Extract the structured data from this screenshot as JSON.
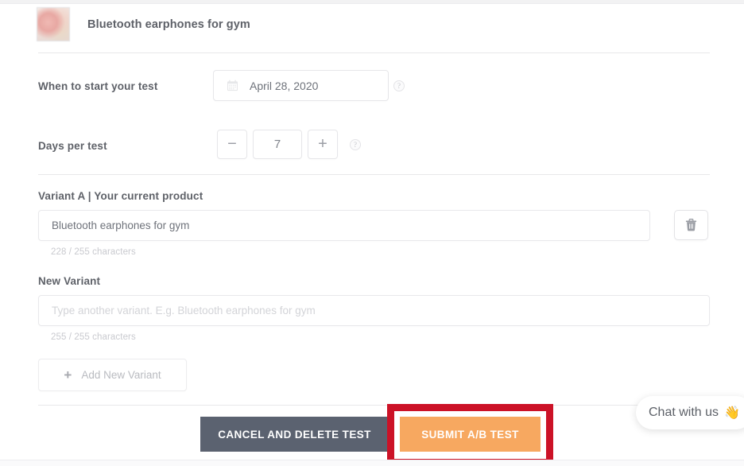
{
  "product": {
    "title": "Bluetooth earphones for gym",
    "thumbnail_icon": "product-thumbnail-image"
  },
  "form": {
    "start_date": {
      "label": "When to start your test",
      "value": "April 28, 2020",
      "calendar_icon": "calendar-icon",
      "help_icon": "?"
    },
    "days_per_test": {
      "label": "Days per test",
      "value": "7",
      "decrement_label": "−",
      "increment_label": "+",
      "help_icon": "?"
    },
    "variant_a": {
      "label": "Variant A | Your current product",
      "value": "Bluetooth earphones for gym",
      "placeholder": "",
      "counter": "228 / 255 characters",
      "delete_icon": "trash-icon"
    },
    "new_variant": {
      "label": "New Variant",
      "value": "",
      "placeholder": "Type another variant. E.g. Bluetooth earphones for gym",
      "counter": "255 / 255 characters"
    },
    "add_variant": {
      "label": "Add New Variant",
      "plus_icon": "+"
    }
  },
  "actions": {
    "cancel_label": "CANCEL AND DELETE TEST",
    "submit_label": "SUBMIT A/B TEST"
  },
  "chat": {
    "label": "Chat with us",
    "emoji": "👋"
  },
  "colors": {
    "submit_orange": "#f7a860",
    "cancel_slate": "#5b6270",
    "annotation_red": "#cc1227",
    "label_text": "#5e6168",
    "muted_text": "#c9cacf"
  }
}
